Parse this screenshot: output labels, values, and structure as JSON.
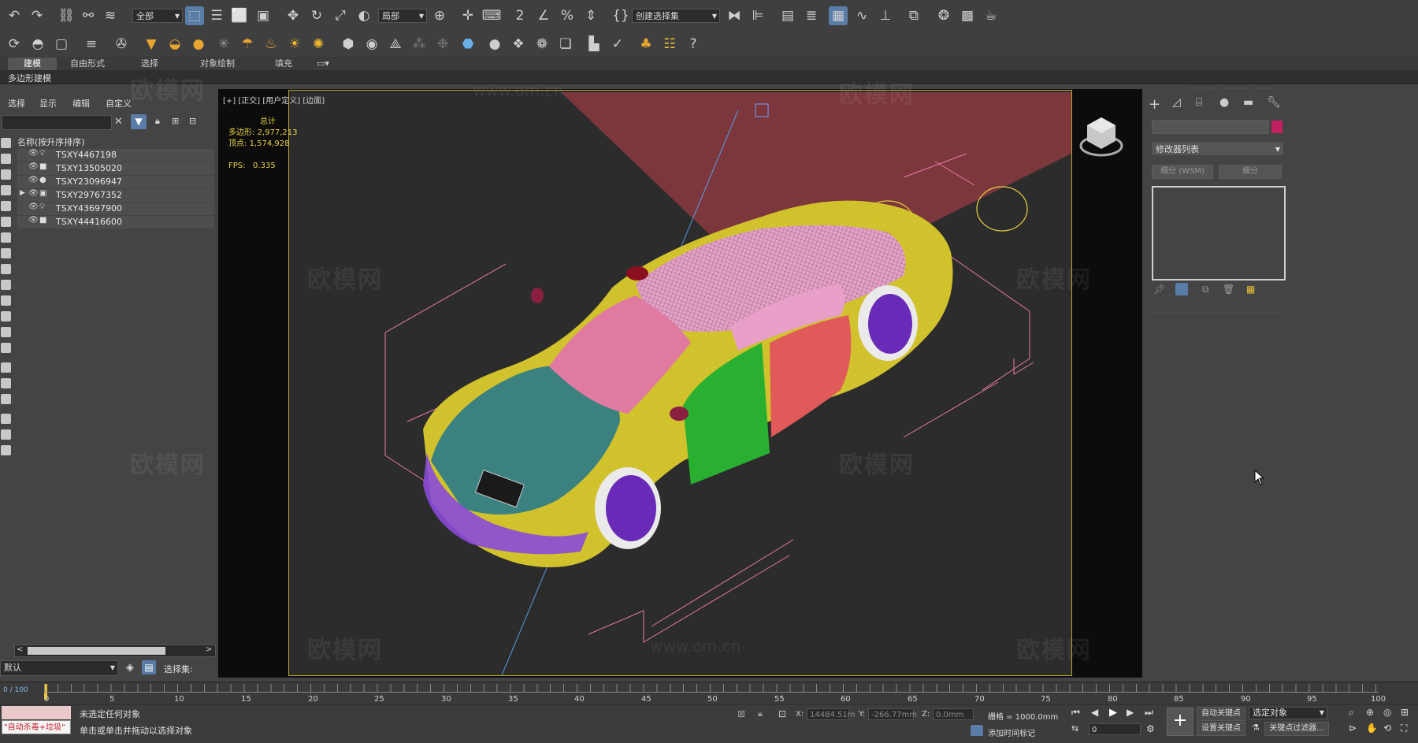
{
  "toolbar": {
    "filter_dropdown": "全部",
    "coord_dropdown": "局部",
    "selection_set_dropdown": "创建选择集"
  },
  "ribbon": {
    "tabs": [
      "建模",
      "自由形式",
      "选择",
      "对象绘制",
      "填充"
    ],
    "sub_label": "多边形建模"
  },
  "explorer": {
    "menu": [
      "选择",
      "显示",
      "编辑",
      "自定义"
    ],
    "column_header": "名称(按升序排序)",
    "items": [
      {
        "name": "TSXY4467198",
        "icon": "light-icon"
      },
      {
        "name": "TSXY13505020",
        "icon": "camera-icon"
      },
      {
        "name": "TSXY23096947",
        "icon": "sphere-icon"
      },
      {
        "name": "TSXY29767352",
        "icon": "group-icon"
      },
      {
        "name": "TSXY43697900",
        "icon": "light-icon"
      },
      {
        "name": "TSXY44416600",
        "icon": "camera-icon"
      }
    ],
    "layer_dropdown": "默认",
    "selection_set_label": "选择集:"
  },
  "viewport": {
    "label": "[+] [正交] [用户定义] [边面]",
    "stats_title": "总计",
    "polys_label": "多边形:",
    "polys_value": "2,977,213",
    "verts_label": "顶点:",
    "verts_value": "1,574,928",
    "fps_label": "FPS:",
    "fps_value": "0.335"
  },
  "command_panel": {
    "modifier_list": "修改器列表",
    "btn_subdiv_wsm": "细分 (WSM)",
    "btn_subdiv": "细分",
    "color_swatch": "#c2205e"
  },
  "timeline": {
    "slider": "0 / 100",
    "ticks": [
      "0",
      "5",
      "10",
      "15",
      "20",
      "25",
      "30",
      "35",
      "40",
      "45",
      "50",
      "55",
      "60",
      "65",
      "70",
      "75",
      "80",
      "85",
      "90",
      "95",
      "100"
    ]
  },
  "statusbar": {
    "script_field": "\"自动杀毒+垃圾\"",
    "status_1": "未选定任何对象",
    "status_2": "单击或单击并拖动以选择对象",
    "x_label": "X:",
    "x_value": "14484.51m",
    "y_label": "Y:",
    "y_value": "-266.77mm",
    "z_label": "Z:",
    "z_value": "0.0mm",
    "grid": "栅格 = 1000.0mm",
    "add_time_tag": "添加时间标记",
    "auto_key": "自动关键点",
    "selected_object": "选定对象",
    "set_key": "设置关键点",
    "key_filter": "关键点过滤器...",
    "frame": "0"
  },
  "watermarks": {
    "brand": "欧模网",
    "url": "www.om.cn"
  },
  "colors": {
    "accent": "#5a7da8",
    "safe_frame": "#b8a43a",
    "stats_text": "#e8d24a"
  }
}
